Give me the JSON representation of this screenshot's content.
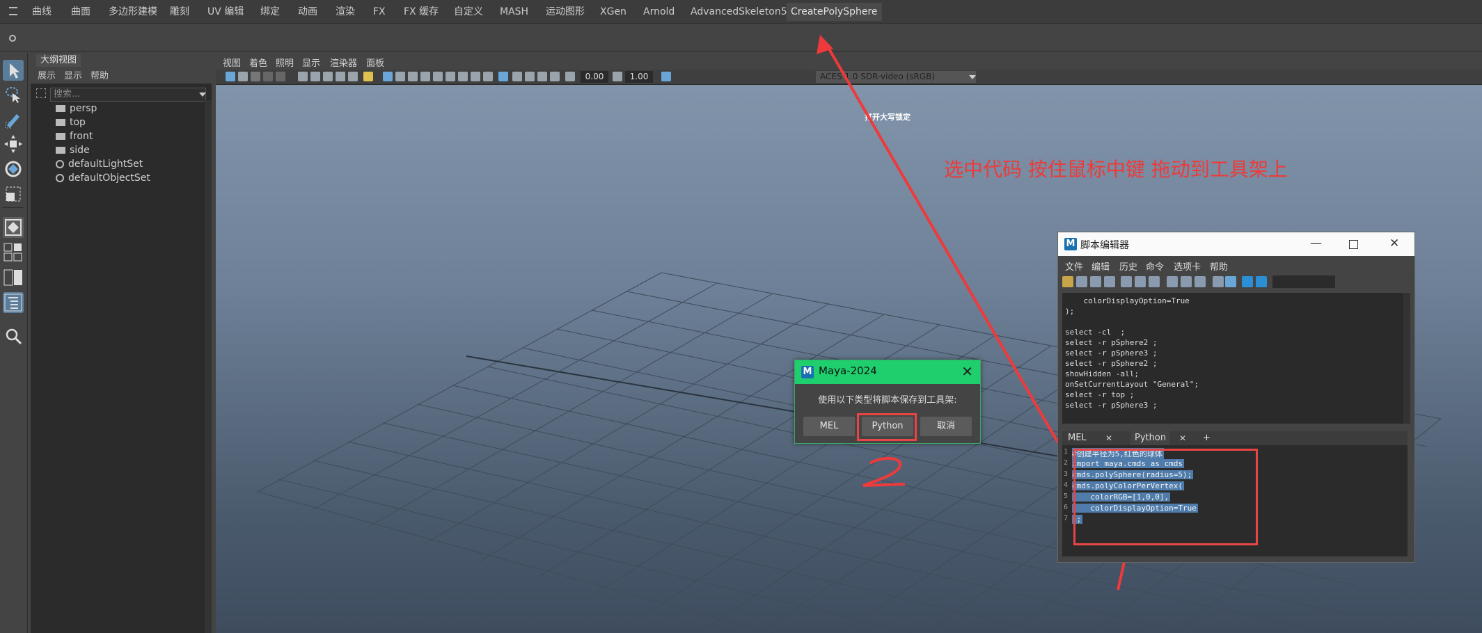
{
  "shelf_tabs": [
    "曲线",
    "曲面",
    "多边形建模",
    "雕刻",
    "UV 编辑",
    "绑定",
    "动画",
    "渲染",
    "FX",
    "FX 缓存",
    "自定义",
    "MASH",
    "运动图形",
    "XGen",
    "Arnold",
    "AdvancedSkeleton5",
    "CreatePolySphere"
  ],
  "active_shelf": "CreatePolySphere",
  "outliner": {
    "title": "大纲视图",
    "menu": [
      "展示",
      "显示",
      "帮助"
    ],
    "search_placeholder": "搜索...",
    "items": [
      "persp",
      "top",
      "front",
      "side",
      "defaultLightSet",
      "defaultObjectSet"
    ]
  },
  "viewport": {
    "menu": [
      "视图",
      "着色",
      "照明",
      "显示",
      "渲染器",
      "面板"
    ],
    "field1": "0.00",
    "field2": "1.00",
    "colorspace": "ACES 1.0 SDR-video (sRGB)",
    "hud": "打开大写锁定"
  },
  "annotation": "选中代码 按住鼠标中键 拖动到工具架上",
  "dialog": {
    "title": "Maya-2024",
    "close": "✕",
    "message": "使用以下类型将脚本保存到工具架:",
    "buttons": [
      "MEL",
      "Python",
      "取消"
    ]
  },
  "script_editor": {
    "title": "脚本编辑器",
    "menu": [
      "文件",
      "编辑",
      "历史",
      "命令",
      "选项卡",
      "帮助"
    ],
    "history_lines": [
      "    colorDisplayOption=True",
      ");",
      "",
      "select -cl  ;",
      "select -r pSphere2 ;",
      "select -r pSphere3 ;",
      "select -r pSphere2 ;",
      "showHidden -all;",
      "onSetCurrentLayout \"General\";",
      "select -r top ;",
      "select -r pSphere3 ;"
    ],
    "tabs": [
      "MEL",
      "Python",
      "+"
    ],
    "code_lines": [
      "#创建半径为5,红色的球体",
      "import maya.cmds as cmds",
      "cmds.polySphere(radius=5);",
      "cmds.polyColorPerVertex(",
      "    colorRGB=[1,0,0],",
      "    colorDisplayOption=True",
      ");"
    ],
    "line_numbers": [
      "1",
      "2",
      "3",
      "4",
      "5",
      "6",
      "7"
    ]
  },
  "marks": {
    "one": "1",
    "two": "2"
  },
  "colors": {
    "accent_green": "#1fcf6d",
    "annotation_red": "#ee3a3a",
    "selection_blue": "#4f7cab"
  }
}
